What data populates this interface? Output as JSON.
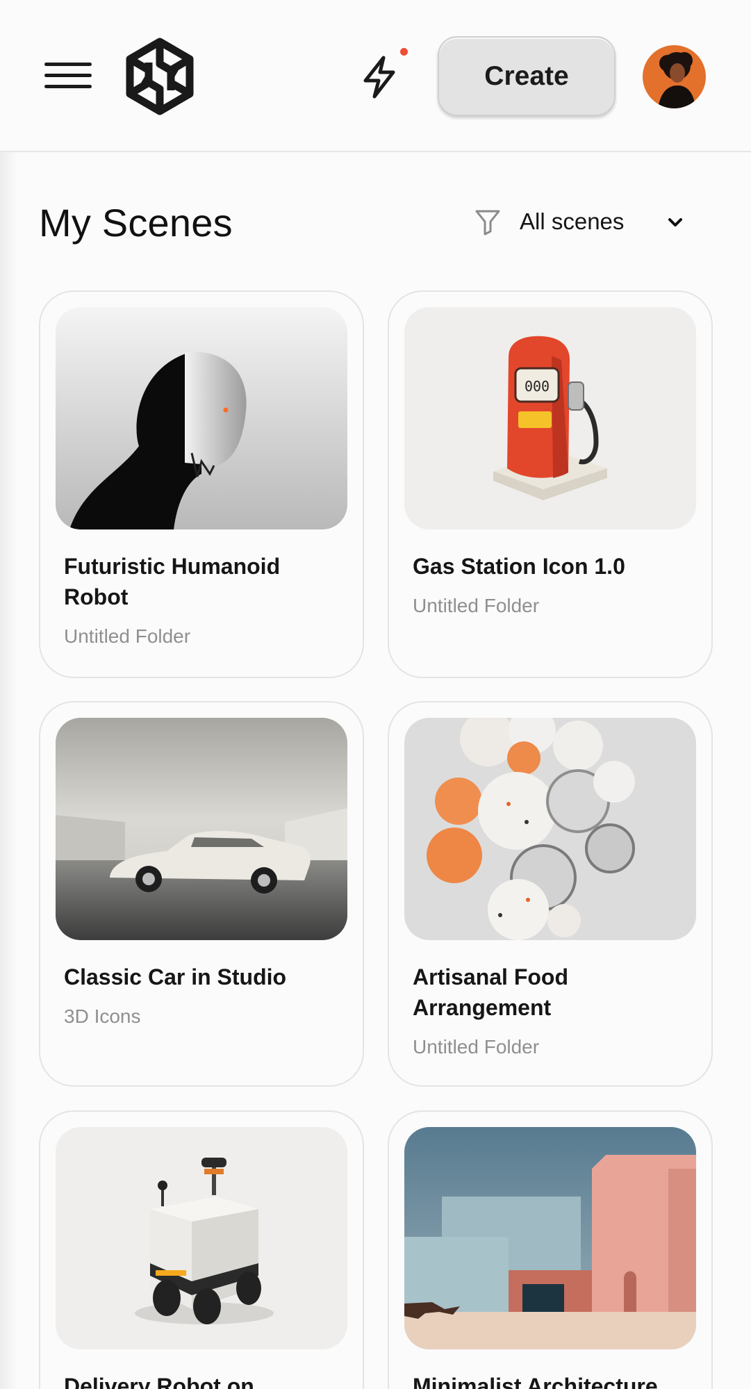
{
  "header": {
    "menu_icon": "hamburger-menu-icon",
    "logo_icon": "hexagon-knot-logo",
    "bolt_icon": "lightning-bolt-icon",
    "create_label": "Create",
    "avatar_icon": "user-avatar"
  },
  "colors": {
    "accent": "#ee4d35",
    "avatar_bg": "#e3702b",
    "title_text": "#161616",
    "muted_text": "#8f8f8f"
  },
  "page": {
    "title": "My Scenes",
    "filter_icon": "funnel-icon",
    "filter_label": "All scenes",
    "filter_chevron": "chevron-down-icon"
  },
  "scenes": [
    {
      "title": "Futuristic Humanoid Robot",
      "folder": "Untitled Folder"
    },
    {
      "title": "Gas Station Icon 1.0",
      "folder": "Untitled Folder"
    },
    {
      "title": "Classic Car in Studio",
      "folder": "3D Icons"
    },
    {
      "title": "Artisanal Food Arrangement",
      "folder": "Untitled Folder"
    },
    {
      "title": "Delivery Robot on",
      "folder": ""
    },
    {
      "title": "Minimalist Architecture",
      "folder": ""
    }
  ]
}
